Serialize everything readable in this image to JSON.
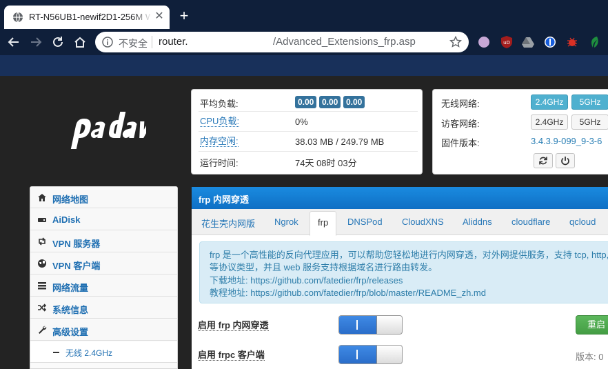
{
  "browser": {
    "tab_title": "RT-N56UB1-newif2D1-256M W",
    "new_tab_symbol": "+",
    "close_symbol": "✕",
    "security_label": "不安全",
    "url_host": "router.",
    "url_path": "/Advanced_Extensions_frp.asp",
    "colors": {
      "frame": "#0f1f3a",
      "band": "#18305a"
    }
  },
  "status": {
    "load_label": "平均负载:",
    "load_values": [
      "0.00",
      "0.00",
      "0.00"
    ],
    "cpu_label": "CPU负载:",
    "cpu_value": "0%",
    "mem_label": "内存空闲:",
    "mem_value": "38.03 MB / 249.79 MB",
    "uptime_label": "运行时间:",
    "uptime_value": "74天 08时 03分"
  },
  "wireless": {
    "wifi_label": "无线网络:",
    "guest_label": "访客网络:",
    "firmware_label": "固件版本:",
    "band_24": "2.4GHz",
    "band_5": "5GHz",
    "firmware_value": "3.4.3.9-099_9-3-6"
  },
  "sidebar": {
    "items": [
      {
        "label": "网络地图",
        "icon": "home-icon"
      },
      {
        "label": "AiDisk",
        "icon": "disk-icon"
      },
      {
        "label": "VPN 服务器",
        "icon": "retweet-icon"
      },
      {
        "label": "VPN 客户端",
        "icon": "globe-icon"
      },
      {
        "label": "网络流量",
        "icon": "list-icon"
      },
      {
        "label": "系统信息",
        "icon": "shuffle-icon"
      },
      {
        "label": "高级设置",
        "icon": "wrench-icon"
      }
    ],
    "sub_item": "无线 2.4GHz"
  },
  "panel": {
    "title": "frp 内网穿透",
    "tabs": [
      "花生壳内网版",
      "Ngrok",
      "frp",
      "DNSPod",
      "CloudXNS",
      "Aliddns",
      "cloudflare",
      "qcloud"
    ],
    "active_tab": 2,
    "notice": {
      "line1": "frp 是一个高性能的反向代理应用，可以帮助您轻松地进行内网穿透，对外网提供服务，支持 tcp, http,",
      "line2": "等协议类型，并且 web 服务支持根据域名进行路由转发。",
      "line3": "下载地址: https://github.com/fatedier/frp/releases",
      "line4": "教程地址: https://github.com/fatedier/frp/blob/master/README_zh.md"
    },
    "enable_frp_label": "启用 frp 内网穿透",
    "enable_frpc_label": "启用 frpc 客户端",
    "toggle_on_label": "I",
    "restart_label": "重启",
    "version_label": "版本: 0",
    "colors": {
      "header": "#1a8be0",
      "notice_bg": "#d9ecf6",
      "toggle_on": "#3f8ae5",
      "restart": "#5cb85c"
    }
  }
}
